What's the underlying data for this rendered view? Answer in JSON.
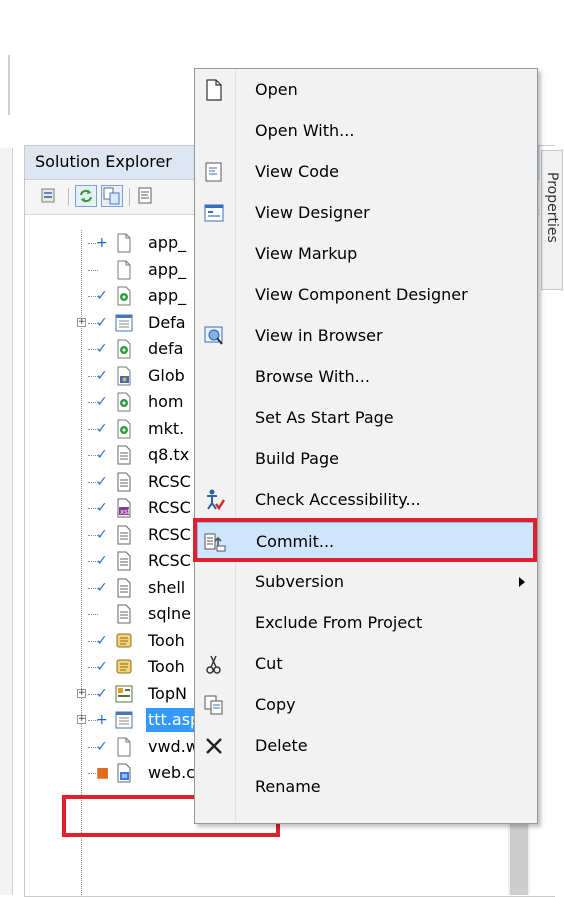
{
  "solution_explorer": {
    "title": "Solution Explorer"
  },
  "properties_tab": {
    "label": "Properties"
  },
  "tree_items": [
    {
      "name": "app_",
      "status": "+",
      "status_color": "#1a5fd6",
      "icon": "blank-file-icon",
      "expander": false
    },
    {
      "name": "app_",
      "status": "",
      "status_color": "#2b6fcf",
      "icon": "blank-file-icon",
      "expander": false
    },
    {
      "name": "app_",
      "status": "✓",
      "status_color": "#2b6fcf",
      "icon": "page-icon",
      "expander": false
    },
    {
      "name": "Defa",
      "status": "✓",
      "status_color": "#2b6fcf",
      "icon": "form-icon",
      "expander": true
    },
    {
      "name": "defa",
      "status": "✓",
      "status_color": "#2b6fcf",
      "icon": "page-icon",
      "expander": false
    },
    {
      "name": "Glob",
      "status": "✓",
      "status_color": "#2b6fcf",
      "icon": "global-asax-icon",
      "expander": false
    },
    {
      "name": "hom",
      "status": "✓",
      "status_color": "#2b6fcf",
      "icon": "page-icon",
      "expander": false
    },
    {
      "name": "mkt.",
      "status": "✓",
      "status_color": "#2b6fcf",
      "icon": "page-icon",
      "expander": false
    },
    {
      "name": "q8.tx",
      "status": "✓",
      "status_color": "#2b6fcf",
      "icon": "text-file-icon",
      "expander": false
    },
    {
      "name": "RCSC",
      "status": "✓",
      "status_color": "#2b6fcf",
      "icon": "text-file-icon",
      "expander": false
    },
    {
      "name": "RCSC",
      "status": "✓",
      "status_color": "#2b6fcf",
      "icon": "xml-file-icon",
      "expander": false
    },
    {
      "name": "RCSC",
      "status": "✓",
      "status_color": "#2b6fcf",
      "icon": "text-file-icon",
      "expander": false
    },
    {
      "name": "RCSC",
      "status": "✓",
      "status_color": "#2b6fcf",
      "icon": "text-file-icon",
      "expander": false
    },
    {
      "name": "shell",
      "status": "✓",
      "status_color": "#2b6fcf",
      "icon": "text-file-icon",
      "expander": false
    },
    {
      "name": "sqlne",
      "status": "",
      "status_color": "#2b6fcf",
      "icon": "text-file-icon",
      "expander": false
    },
    {
      "name": "Tooh",
      "status": "✓",
      "status_color": "#2b6fcf",
      "icon": "script-icon",
      "expander": false
    },
    {
      "name": "Tooh",
      "status": "✓",
      "status_color": "#2b6fcf",
      "icon": "script-icon",
      "expander": false
    },
    {
      "name": "TopN",
      "status": "✓",
      "status_color": "#2b6fcf",
      "icon": "control-icon",
      "expander": true
    },
    {
      "name": "ttt.aspx",
      "status": "+",
      "status_color": "#1a5fd6",
      "icon": "form-icon",
      "expander": true,
      "selected": true
    },
    {
      "name": "vwd.webinfo",
      "status": "✓",
      "status_color": "#2b6fcf",
      "icon": "blank-file-icon",
      "expander": false
    },
    {
      "name": "web.config",
      "status": "■",
      "status_color": "#e06c1f",
      "icon": "config-icon",
      "expander": false
    }
  ],
  "context_menu": {
    "items": [
      {
        "label": "Open",
        "icon": "open-file-icon"
      },
      {
        "label": "Open With...",
        "icon": ""
      },
      {
        "label": "View Code",
        "icon": "view-code-icon"
      },
      {
        "label": "View Designer",
        "icon": "view-designer-icon"
      },
      {
        "label": "View Markup",
        "icon": ""
      },
      {
        "label": "View Component Designer",
        "icon": ""
      },
      {
        "label": "View in Browser",
        "icon": "view-in-browser-icon"
      },
      {
        "label": "Browse With...",
        "icon": ""
      },
      {
        "label": "Set As Start Page",
        "icon": ""
      },
      {
        "label": "Build Page",
        "icon": ""
      },
      {
        "label": "Check Accessibility...",
        "icon": "accessibility-icon"
      },
      {
        "label": "Commit...",
        "icon": "commit-icon",
        "hover": true
      },
      {
        "label": "Subversion",
        "icon": "",
        "submenu": true
      },
      {
        "label": "Exclude From Project",
        "icon": ""
      },
      {
        "label": "Cut",
        "icon": "cut-icon"
      },
      {
        "label": "Copy",
        "icon": "copy-icon"
      },
      {
        "label": "Delete",
        "icon": "delete-icon"
      },
      {
        "label": "Rename",
        "icon": ""
      }
    ]
  },
  "colors": {
    "highlight_box": "#e0202f",
    "selection": "#3399ff",
    "menu_hover": "#cfe5fb"
  }
}
